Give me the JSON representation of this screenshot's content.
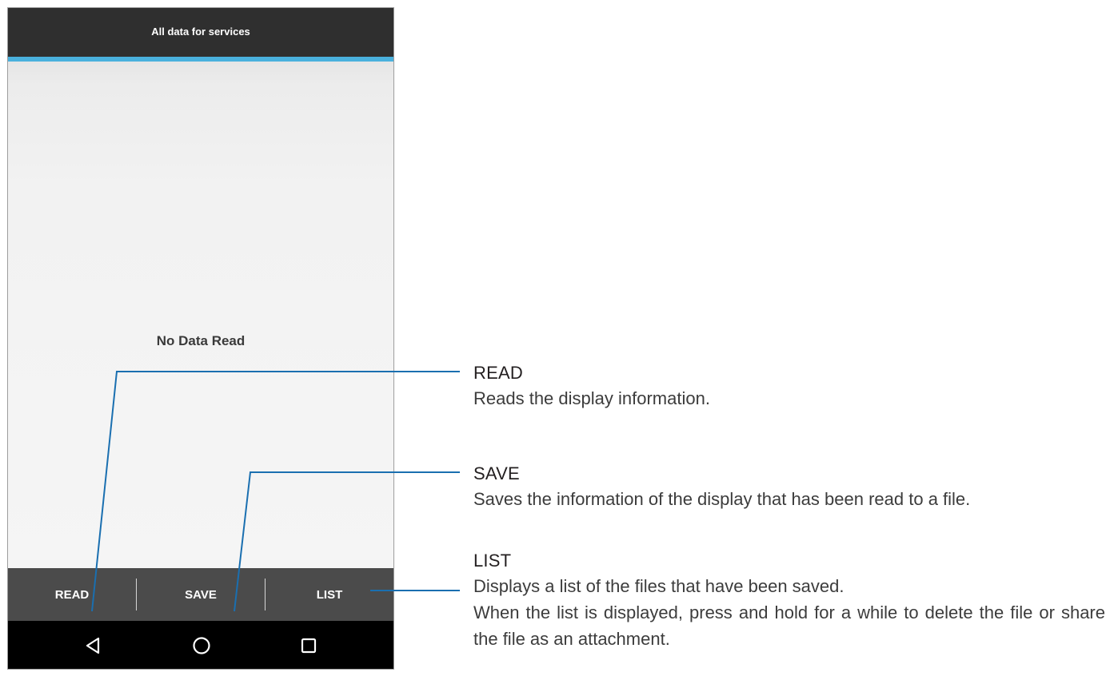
{
  "app": {
    "title": "All data for services",
    "empty_message": "No Data Read"
  },
  "buttons": {
    "read": "READ",
    "save": "SAVE",
    "list": "LIST"
  },
  "nav": {
    "back_icon": "back-triangle-icon",
    "home_icon": "home-circle-icon",
    "recents_icon": "recents-square-icon"
  },
  "colors": {
    "app_bar": "#2f2f2f",
    "accent": "#4ab1dd",
    "button_bar": "#4b4b4b",
    "callout_line": "#1a6fb0"
  },
  "annotations": {
    "read": {
      "title": "READ",
      "desc": "Reads the display information."
    },
    "save": {
      "title": "SAVE",
      "desc": "Saves the information of the display that has been read to a file."
    },
    "list": {
      "title": "LIST",
      "desc_line1": "Displays a list of the files that have been saved.",
      "desc_line2": "When the list is displayed, press and hold for a while to delete the file or share the file as an attachment."
    }
  }
}
